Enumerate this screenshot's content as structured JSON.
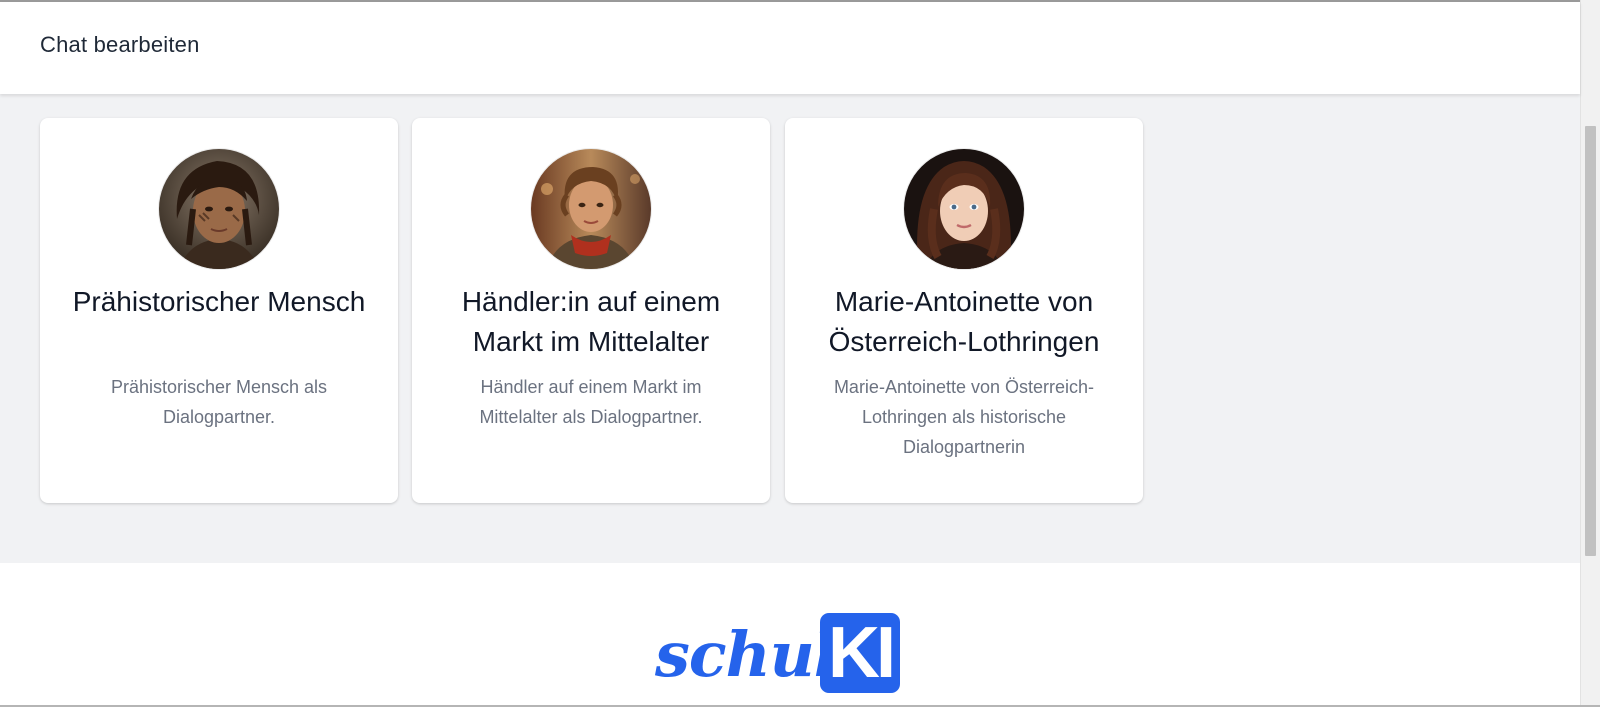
{
  "header": {
    "title": "Chat bearbeiten"
  },
  "cards": [
    {
      "title": "Prähistorischer Mensch",
      "description": "Prähistorischer Mensch als Dialogpartner.",
      "avatar_icon": "prehistoric-human-avatar"
    },
    {
      "title": "Händler:in auf einem Markt im Mittelalter",
      "description": "Händler auf einem Markt im Mittelalter als Dialogpartner.",
      "avatar_icon": "medieval-merchant-avatar"
    },
    {
      "title": "Marie-Antoinette von Österreich-Lothringen",
      "description": "Marie-Antoinette von Österreich-Lothringen als historische Dialogpartnerin",
      "avatar_icon": "marie-antoinette-avatar"
    }
  ],
  "footer": {
    "logo_script": "schul",
    "logo_badge": "KI"
  },
  "colors": {
    "brand": "#2563eb",
    "page_bg": "#f1f2f4",
    "title_text": "#111827",
    "muted_text": "#6b7280"
  }
}
